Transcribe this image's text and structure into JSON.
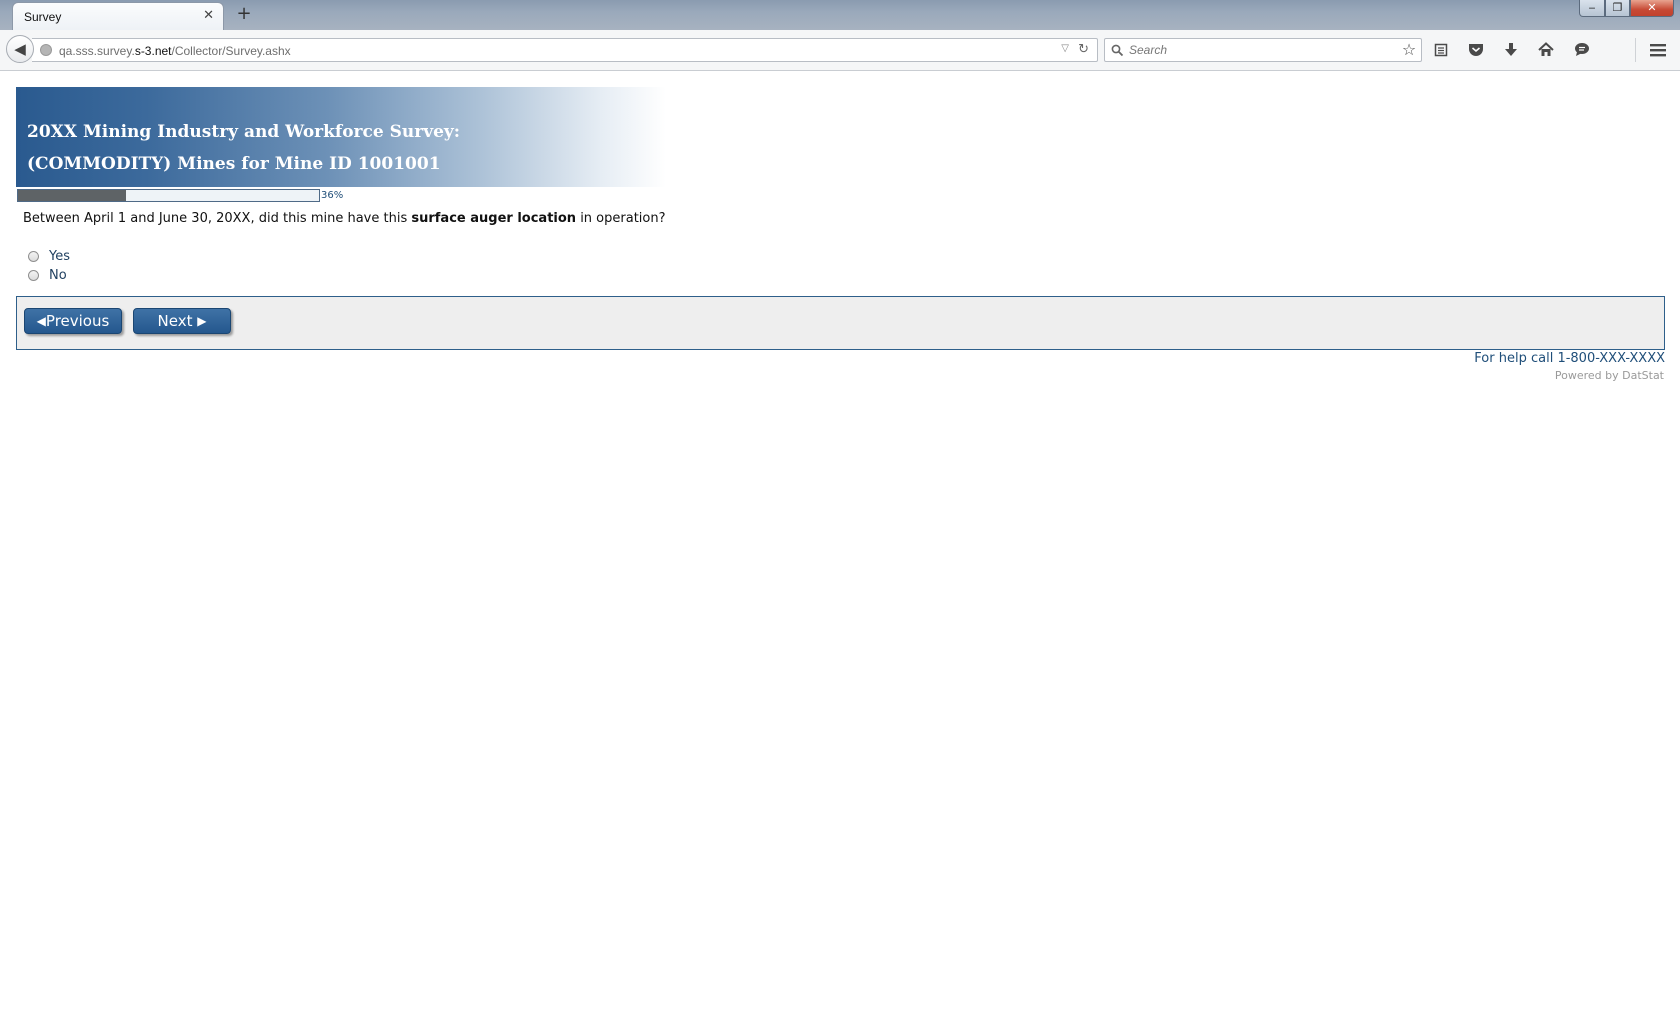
{
  "browser": {
    "tab_title": "Survey",
    "tab_close": "✕",
    "new_tab": "+",
    "url_prefix": "qa.sss.survey.",
    "url_host": "s-3.net",
    "url_path": "/Collector/Survey.ashx",
    "search_placeholder": "Search",
    "window_controls": {
      "minimize": "‒",
      "maximize": "❐",
      "close": "✕"
    },
    "toolbar_icons": [
      "star-icon",
      "reading-list-icon",
      "pocket-icon",
      "download-icon",
      "home-icon",
      "chat-icon",
      "menu-icon"
    ]
  },
  "survey": {
    "title_line1": "20XX Mining Industry and Workforce Survey:",
    "title_line2": "(COMMODITY) Mines for Mine ID 1001001",
    "progress_percent": 36,
    "progress_label": "36%",
    "question_prefix": "Between April 1 and June 30, 20XX, did this mine have this ",
    "question_emphasis": "surface auger location",
    "question_suffix": " in operation?",
    "options": [
      {
        "label": "Yes",
        "selected": false
      },
      {
        "label": "No",
        "selected": false
      }
    ],
    "buttons": {
      "previous": "Previous",
      "next": "Next"
    },
    "help_text": "For help call 1-800-XXX-XXXX",
    "powered_by": "Powered by DatStat"
  },
  "colors": {
    "banner_dark": "#2a5a8f",
    "button_blue": "#24578e",
    "progress_fill": "#5e6366",
    "link_blue": "#1f4e79"
  }
}
